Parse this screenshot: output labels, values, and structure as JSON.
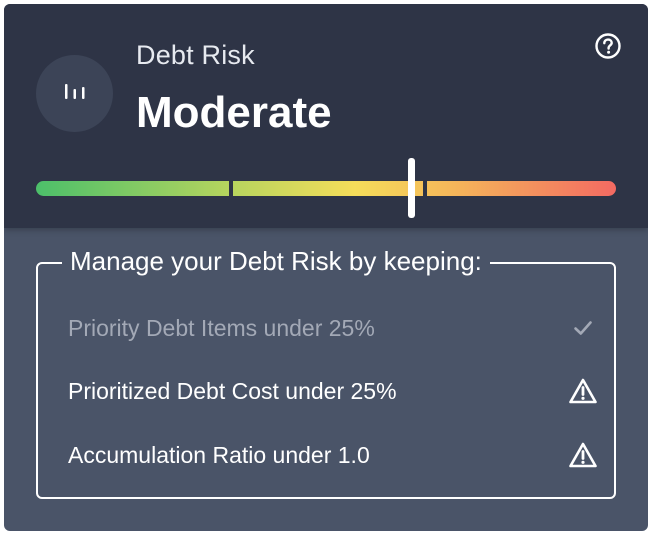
{
  "header": {
    "title": "Debt Risk",
    "level": "Moderate",
    "avatar_icon": "bar-chart-icon",
    "help_icon": "help-circle-icon"
  },
  "meter": {
    "segments": 3,
    "marker_percent": 65,
    "gradient": [
      "#4cbf6a",
      "#b5d45e",
      "#f5dd5a",
      "#f5b65a",
      "#f36a62"
    ]
  },
  "tips": {
    "title": "Manage your Debt Risk by keeping:",
    "items": [
      {
        "label": "Priority Debt Items under 25%",
        "status": "done",
        "icon": "check-icon"
      },
      {
        "label": "Prioritized Debt Cost under 25%",
        "status": "warning",
        "icon": "warning-icon"
      },
      {
        "label": "Accumulation Ratio under 1.0",
        "status": "warning",
        "icon": "warning-icon"
      }
    ]
  },
  "colors": {
    "header_bg": "#2e3446",
    "body_bg": "#4a5468",
    "done_text": "#a3a9b6"
  }
}
